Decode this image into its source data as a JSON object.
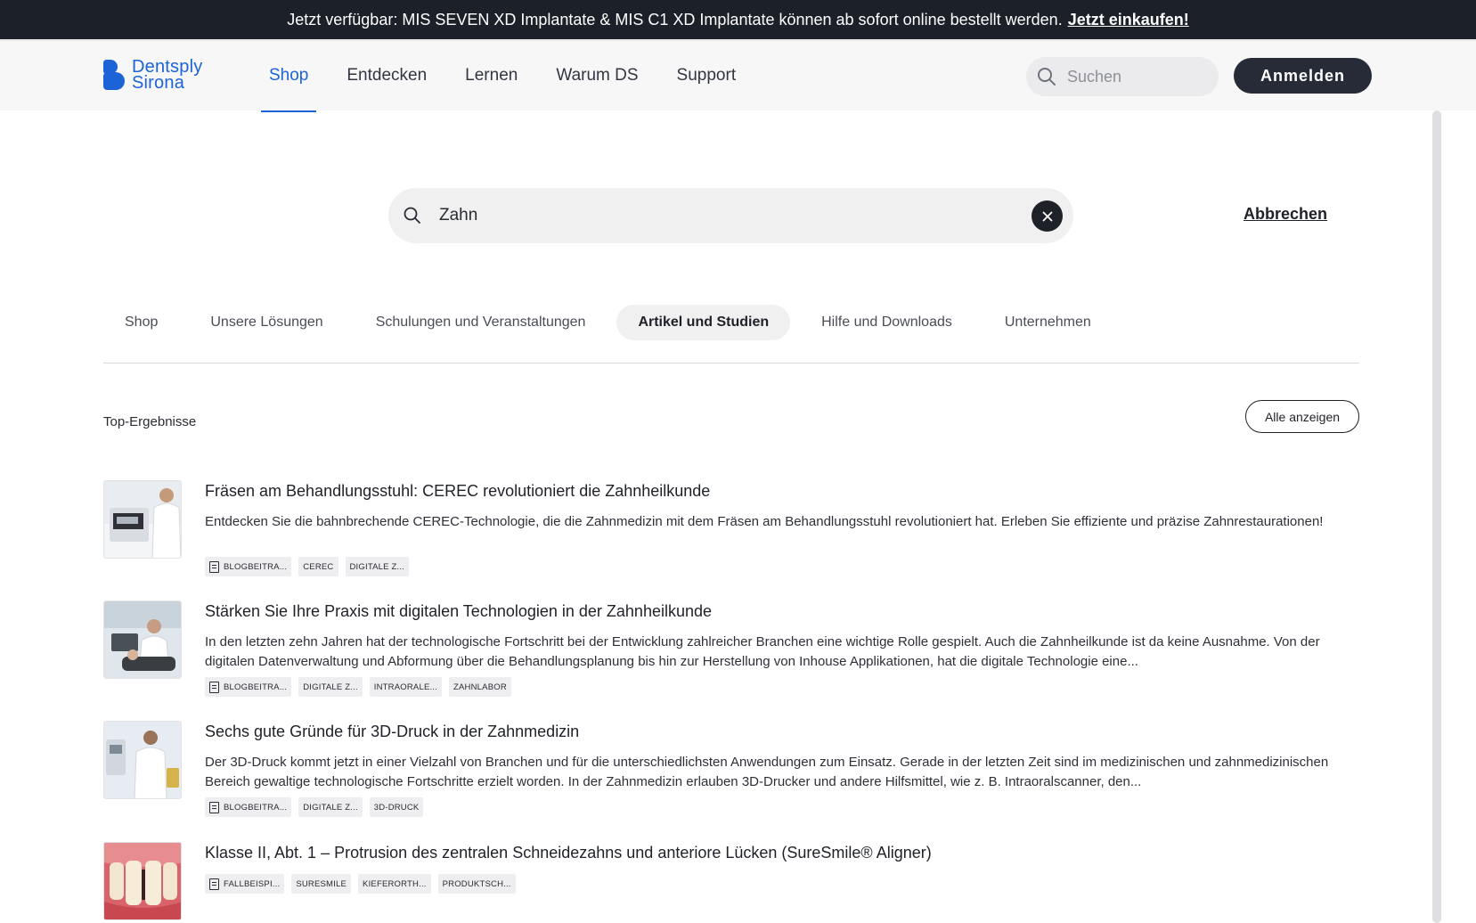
{
  "announcement": {
    "text": "Jetzt verfügbar: MIS SEVEN XD Implantate & MIS C1 XD Implantate können ab sofort online bestellt werden.",
    "link": "Jetzt einkaufen!"
  },
  "brand": {
    "line1": "Dentsply",
    "line2": "Sirona",
    "color": "#1c63d8"
  },
  "nav": {
    "items": [
      "Shop",
      "Entdecken",
      "Lernen",
      "Warum DS",
      "Support"
    ],
    "active": "Shop"
  },
  "header": {
    "search_placeholder": "Suchen",
    "login_label": "Anmelden"
  },
  "search": {
    "value": "Zahn",
    "cancel_label": "Abbrechen"
  },
  "tabs": {
    "items": [
      "Shop",
      "Unsere Lösungen",
      "Schulungen und Veranstaltungen",
      "Artikel und Studien",
      "Hilfe und Downloads",
      "Unternehmen"
    ],
    "active": "Artikel und Studien"
  },
  "results": {
    "label": "Top-Ergebnisse",
    "show_all": "Alle anzeigen",
    "items": [
      {
        "title": "Fräsen am Behandlungsstuhl: CEREC revolutioniert die Zahnheilkunde",
        "description": "Entdecken Sie die bahnbrechende CEREC-Technologie, die die Zahnmedizin mit dem Fräsen am Behandlungsstuhl revolutioniert hat. Erleben Sie effiziente und präzise Zahnrestaurationen!",
        "tags": [
          "BLOGBEITRA...",
          "CEREC",
          "DIGITALE Z..."
        ]
      },
      {
        "title": "Stärken Sie Ihre Praxis mit digitalen Technologien in der Zahnheilkunde",
        "description": "In den letzten zehn Jahren hat der technologische Fortschritt bei der Entwicklung zahlreicher Branchen eine wichtige Rolle gespielt. Auch die Zahnheilkunde ist da keine Ausnahme. Von der digitalen Datenverwaltung und Abformung über die Behandlungsplanung bis hin zur Herstellung von Inhouse Applikationen, hat die digitale Technologie eine...",
        "tags": [
          "BLOGBEITRA...",
          "DIGITALE Z...",
          "INTRAORALE...",
          "ZAHNLABOR"
        ]
      },
      {
        "title": "Sechs gute Gründe für 3D-Druck in der Zahnmedizin",
        "description": "Der 3D-Druck kommt jetzt in einer Vielzahl von Branchen und für die unterschiedlichsten Anwendungen zum Einsatz. Gerade in der letzten Zeit sind im medizinischen und zahnmedizinischen Bereich gewaltige technologische Fortschritte erzielt worden. In der Zahnmedizin erlauben 3D-Drucker und andere Hilfsmittel, wie z. B. Intraoralscanner, den...",
        "tags": [
          "BLOGBEITRA...",
          "DIGITALE Z...",
          "3D-DRUCK"
        ]
      },
      {
        "title": "Klasse II, Abt. 1 – Protrusion des zentralen Schneidezahns und anteriore Lücken (SureSmile® Aligner)",
        "description": "",
        "tags": [
          "FALLBEISPI...",
          "SURESMILE",
          "KIEFERORTH...",
          "PRODUKTSCH..."
        ]
      }
    ]
  }
}
